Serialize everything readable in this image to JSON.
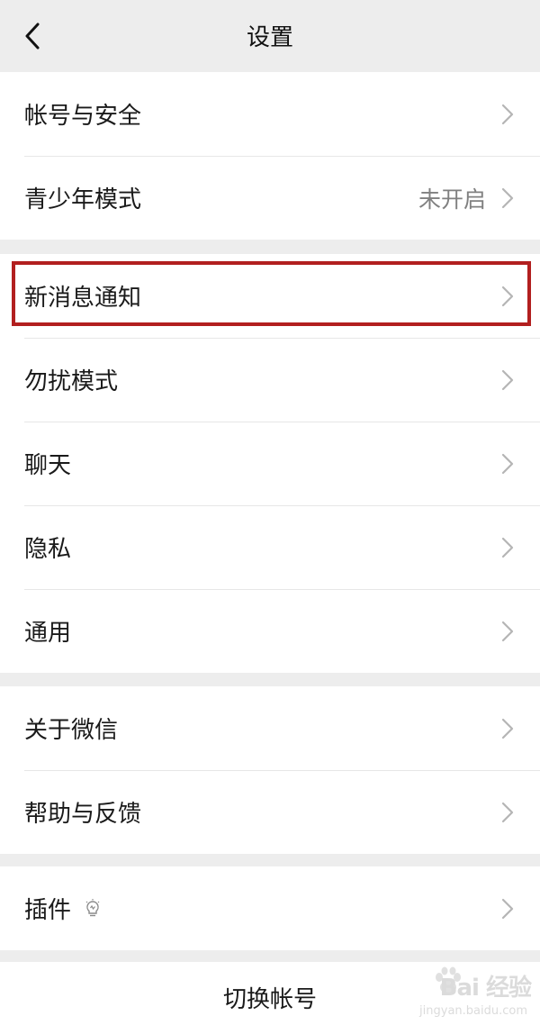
{
  "header": {
    "title": "设置",
    "back_icon": "chevron-left-icon"
  },
  "group1": {
    "items": [
      {
        "label": "帐号与安全",
        "value": ""
      },
      {
        "label": "青少年模式",
        "value": "未开启"
      }
    ]
  },
  "group2": {
    "items": [
      {
        "label": "新消息通知"
      },
      {
        "label": "勿扰模式"
      },
      {
        "label": "聊天"
      },
      {
        "label": "隐私"
      },
      {
        "label": "通用"
      }
    ]
  },
  "group3": {
    "items": [
      {
        "label": "关于微信"
      },
      {
        "label": "帮助与反馈"
      }
    ]
  },
  "group4": {
    "items": [
      {
        "label": "插件",
        "icon": "lightbulb-icon"
      }
    ]
  },
  "footer": {
    "switch_account_label": "切换帐号"
  },
  "watermark": {
    "brand": "Bai 经验",
    "url": "jingyan.baidu.com"
  },
  "colors": {
    "background": "#ededed",
    "highlight": "#b21f1f",
    "secondary_text": "#808080"
  }
}
